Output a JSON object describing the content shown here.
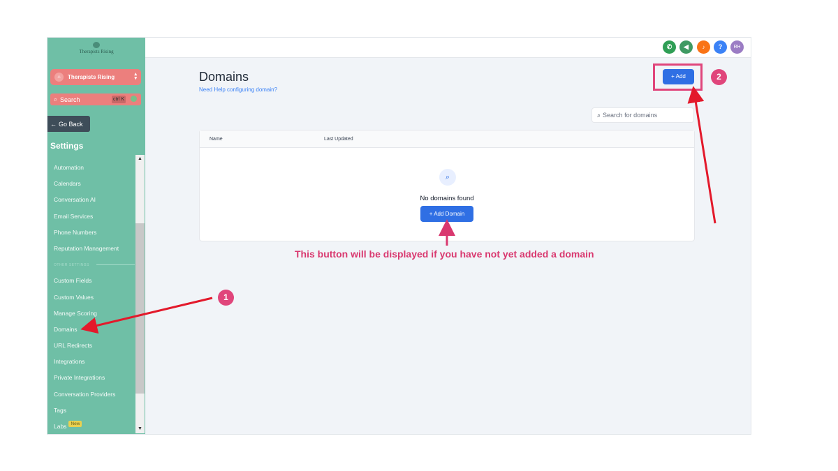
{
  "sidebar": {
    "logo_text": "Therapists Rising",
    "location_name": "Therapists Rising",
    "search_label": "Search",
    "search_shortcut": "ctrl K",
    "go_back_label": "Go Back",
    "settings_title": "Settings",
    "items_top": [
      "Automation",
      "Calendars",
      "Conversation AI",
      "Email Services",
      "Phone Numbers",
      "Reputation Management"
    ],
    "other_settings_label": "OTHER SETTINGS",
    "items_bottom": [
      "Custom Fields",
      "Custom Values",
      "Manage Scoring",
      "Domains",
      "URL Redirects",
      "Integrations",
      "Private Integrations",
      "Conversation Providers",
      "Tags"
    ],
    "labs_label": "Labs",
    "labs_badge": "New"
  },
  "topbar": {
    "icons": [
      {
        "name": "phone-icon",
        "glyph": "✆",
        "color": "#2f9e55"
      },
      {
        "name": "announcement-icon",
        "glyph": "◀",
        "color": "#3f9a63"
      },
      {
        "name": "bell-icon",
        "glyph": "🔔",
        "color": "#f97316"
      },
      {
        "name": "help-icon",
        "glyph": "?",
        "color": "#3b82f6"
      }
    ],
    "avatar_initials": "RH",
    "avatar_color": "#9b7cc4"
  },
  "main": {
    "title": "Domains",
    "help_link": "Need Help configuring domain?",
    "add_button": "+ Add",
    "search_placeholder": "Search for domains",
    "table": {
      "columns": [
        "Name",
        "Last Updated"
      ],
      "empty_text": "No domains found",
      "add_domain_button": "+ Add Domain"
    }
  },
  "annotations": {
    "badge1": "1",
    "badge2": "2",
    "note": "This button will be displayed if you have not yet added a domain",
    "accent_color": "#e0457b",
    "arrow_color": "#e3192b"
  },
  "colors": {
    "sidebar_bg": "#6fbfa6",
    "primary_button": "#2f6fe4",
    "location_bg": "#ec7f7d"
  }
}
